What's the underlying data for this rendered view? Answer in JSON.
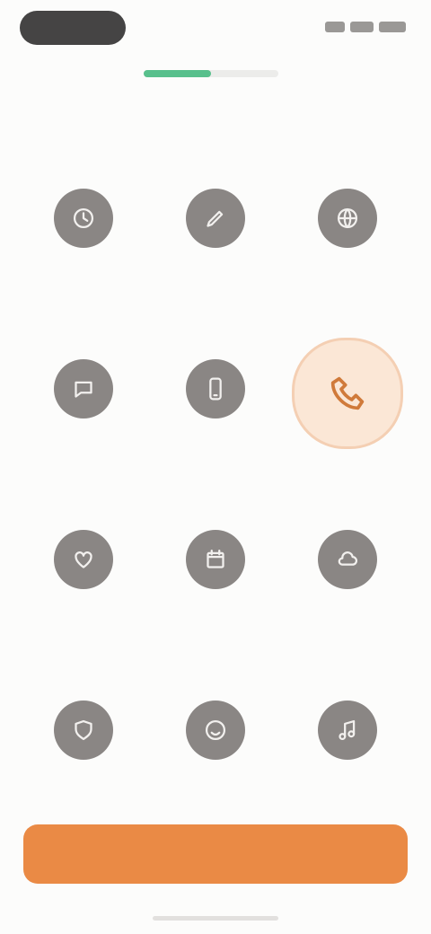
{
  "status_bar": {
    "icons": [
      "signal-icon",
      "wifi-icon",
      "battery-icon"
    ]
  },
  "progress": {
    "value_percent": 50,
    "color": "#58c08c"
  },
  "columns": [
    {
      "label": ""
    },
    {
      "label": ""
    },
    {
      "label": ""
    }
  ],
  "options": [
    {
      "icon": "clock-icon",
      "label": "",
      "selected": false
    },
    {
      "icon": "pen-icon",
      "label": "",
      "selected": false
    },
    {
      "icon": "globe-icon",
      "label": "",
      "selected": false
    },
    {
      "icon": "chat-icon",
      "label": "",
      "selected": false
    },
    {
      "icon": "phone-icon",
      "label": "",
      "selected": false
    },
    {
      "icon": "call-icon",
      "label": "",
      "selected": true
    },
    {
      "icon": "heart-icon",
      "label": "",
      "selected": false
    },
    {
      "icon": "calendar-icon",
      "label": "",
      "selected": false
    },
    {
      "icon": "cloud-icon",
      "label": "",
      "selected": false
    },
    {
      "icon": "shield-icon",
      "label": "",
      "selected": false
    },
    {
      "icon": "smile-icon",
      "label": "",
      "selected": false
    },
    {
      "icon": "music-icon",
      "label": "",
      "selected": false
    }
  ],
  "cta": {
    "label": "",
    "color": "#ea8a45"
  },
  "colors": {
    "accent": "#ea8a45",
    "selected_bg": "#fbe7d6",
    "icon": "#8a8684"
  }
}
